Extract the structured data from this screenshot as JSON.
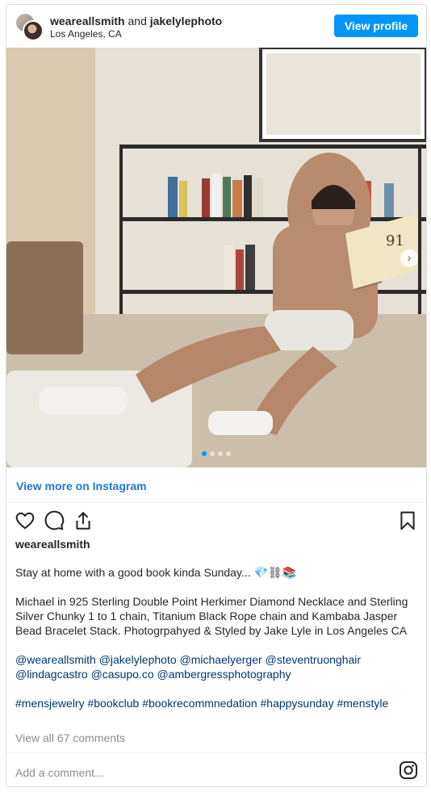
{
  "header": {
    "user1": "weareallsmith",
    "connector": "and",
    "user2": "jakelylephoto",
    "location": "Los Angeles, CA",
    "view_profile_label": "View profile"
  },
  "carousel": {
    "slide_count": 4,
    "active_slide": 1
  },
  "view_more_label": "View more on Instagram",
  "post": {
    "username": "weareallsmith",
    "caption_line1": "Stay at home with a good book kinda Sunday... 💎⛓📚",
    "caption_para2": "Michael in 925 Sterling Double Point Herkimer Diamond Necklace and Sterling Silver Chunky 1 to 1 chain, Titanium Black Rope chain and Kambaba Jasper Bead Bracelet Stack. Photogrpahyed & Styled by Jake Lyle in Los Angeles CA",
    "mentions": "@weareallsmith @jakelylephoto @michaelyerger @steventruonghair @lindagcastro @casupo.co @ambergressphotography",
    "hashtags": "#mensjewelry #bookclub #bookrecommnedation #happysunday #menstyle",
    "view_comments": "View all 67 comments",
    "comment_placeholder": "Add a comment..."
  },
  "icons": {
    "like": "heart-icon",
    "comment": "comment-icon",
    "share": "share-icon",
    "save": "bookmark-icon",
    "instagram": "instagram-icon",
    "next": "chevron-right-icon"
  },
  "colors": {
    "accent": "#0095f6",
    "link": "#1a7ad6",
    "tag": "#00376b",
    "muted": "#8e8e8e"
  }
}
